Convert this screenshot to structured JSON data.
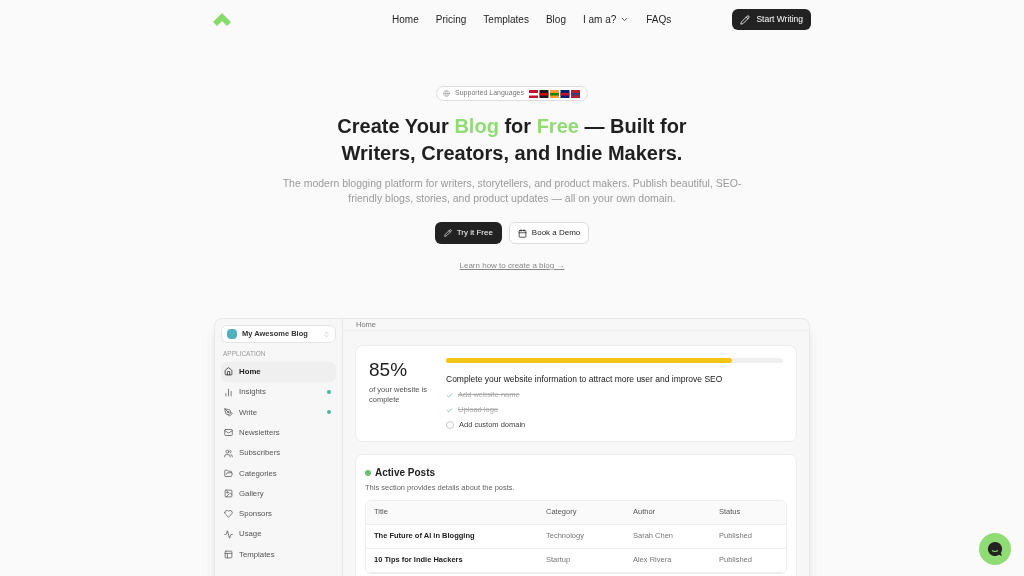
{
  "nav": {
    "links": [
      {
        "label": "Home",
        "dropdown": false
      },
      {
        "label": "Pricing",
        "dropdown": false
      },
      {
        "label": "Templates",
        "dropdown": false
      },
      {
        "label": "Blog",
        "dropdown": false
      },
      {
        "label": "I am a?",
        "dropdown": true
      },
      {
        "label": "FAQs",
        "dropdown": false
      }
    ],
    "cta": "Start Writing"
  },
  "hero": {
    "badge": "Supported Languages",
    "title": [
      {
        "text": "Create Your ",
        "highlight": false
      },
      {
        "text": "Blog",
        "highlight": true
      },
      {
        "text": " for ",
        "highlight": false
      },
      {
        "text": "Free",
        "highlight": true
      },
      {
        "text": " — Built for",
        "highlight": false
      }
    ],
    "title_line2": "Writers, Creators, and Indie Makers.",
    "subtitle": "The modern blogging platform for writers, storytellers, and product makers. Publish beautiful, SEO-friendly blogs, stories, and product updates — all on your own domain.",
    "primary": "Try it Free",
    "secondary": "Book a Demo",
    "link": "Learn how to create a blog →"
  },
  "app": {
    "blog_selector": "My Awesome Blog",
    "section": "APPLICATION",
    "sidebar": [
      {
        "label": "Home",
        "selected": true,
        "dot": false
      },
      {
        "label": "Insights",
        "selected": false,
        "dot": true
      },
      {
        "label": "Write",
        "selected": false,
        "dot": true
      },
      {
        "label": "Newsletters",
        "selected": false,
        "dot": false
      },
      {
        "label": "Subscribers",
        "selected": false,
        "dot": false
      },
      {
        "label": "Categories",
        "selected": false,
        "dot": false
      },
      {
        "label": "Gallery",
        "selected": false,
        "dot": false
      },
      {
        "label": "Sponsors",
        "selected": false,
        "dot": false
      },
      {
        "label": "Usage",
        "selected": false,
        "dot": false
      },
      {
        "label": "Templates",
        "selected": false,
        "dot": false
      }
    ],
    "breadcrumb": "Home",
    "progress": {
      "percent": "85%",
      "caption": "of your website is complete",
      "level": 0.85,
      "heading": "Complete your website information to attract more user and improve SEO",
      "tasks": [
        {
          "label": "Add website name",
          "checked": true
        },
        {
          "label": "Upload logo",
          "checked": true
        },
        {
          "label": "Add custom domain",
          "checked": false
        }
      ]
    },
    "posts": {
      "title": "Active Posts",
      "description": "This section provides details about the posts.",
      "columns": [
        "Title",
        "Category",
        "Author",
        "Status"
      ],
      "rows": [
        [
          "The Future of AI in Blogging",
          "Technology",
          "Sarah Chen",
          "Published"
        ],
        [
          "10 Tips for Indie Hackers",
          "Startup",
          "Alex Rivera",
          "Published"
        ]
      ]
    }
  }
}
